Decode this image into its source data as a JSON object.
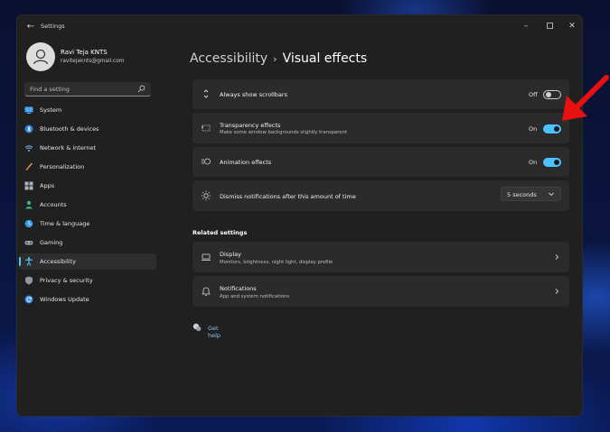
{
  "window": {
    "title": "Settings"
  },
  "colors": {
    "accent": "#4cc2ff",
    "window_bg": "#202020",
    "card_bg": "#2b2b2b",
    "annotation_arrow": "#e81010"
  },
  "profile": {
    "name": "Ravi Teja KNTS",
    "email": "ravitejaknts@gmail.com"
  },
  "search": {
    "placeholder": "Find a setting",
    "icon": "search-icon"
  },
  "sidebar": {
    "selected": "Accessibility",
    "items": [
      {
        "label": "System",
        "icon": "monitor-icon"
      },
      {
        "label": "Bluetooth & devices",
        "icon": "bluetooth-icon"
      },
      {
        "label": "Network & internet",
        "icon": "wifi-icon"
      },
      {
        "label": "Personalization",
        "icon": "brush-icon"
      },
      {
        "label": "Apps",
        "icon": "apps-grid-icon"
      },
      {
        "label": "Accounts",
        "icon": "person-icon"
      },
      {
        "label": "Time & language",
        "icon": "globe-clock-icon"
      },
      {
        "label": "Gaming",
        "icon": "gamepad-icon"
      },
      {
        "label": "Accessibility",
        "icon": "accessibility-icon"
      },
      {
        "label": "Privacy & security",
        "icon": "shield-icon"
      },
      {
        "label": "Windows Update",
        "icon": "refresh-icon"
      }
    ]
  },
  "breadcrumb": {
    "parent": "Accessibility",
    "separator": "›",
    "current": "Visual effects"
  },
  "settings": {
    "scrollbars": {
      "title": "Always show scrollbars",
      "state": "Off",
      "on": false,
      "icon": "scrollbar-icon"
    },
    "transparency": {
      "title": "Transparency effects",
      "subtitle": "Make some window backgrounds slightly transparent",
      "state": "On",
      "on": true,
      "icon": "transparency-icon"
    },
    "animation": {
      "title": "Animation effects",
      "state": "On",
      "on": true,
      "icon": "animation-icon"
    },
    "notifications": {
      "title": "Dismiss notifications after this amount of time",
      "value": "5 seconds",
      "icon": "brightness-icon"
    }
  },
  "related": {
    "title": "Related settings",
    "display": {
      "title": "Display",
      "subtitle": "Monitors, brightness, night light, display profile",
      "icon": "laptop-icon"
    },
    "notifications": {
      "title": "Notifications",
      "subtitle": "App and system notifications",
      "icon": "bell-icon"
    }
  },
  "help": {
    "label": "Get help",
    "icon": "help-chat-icon"
  }
}
